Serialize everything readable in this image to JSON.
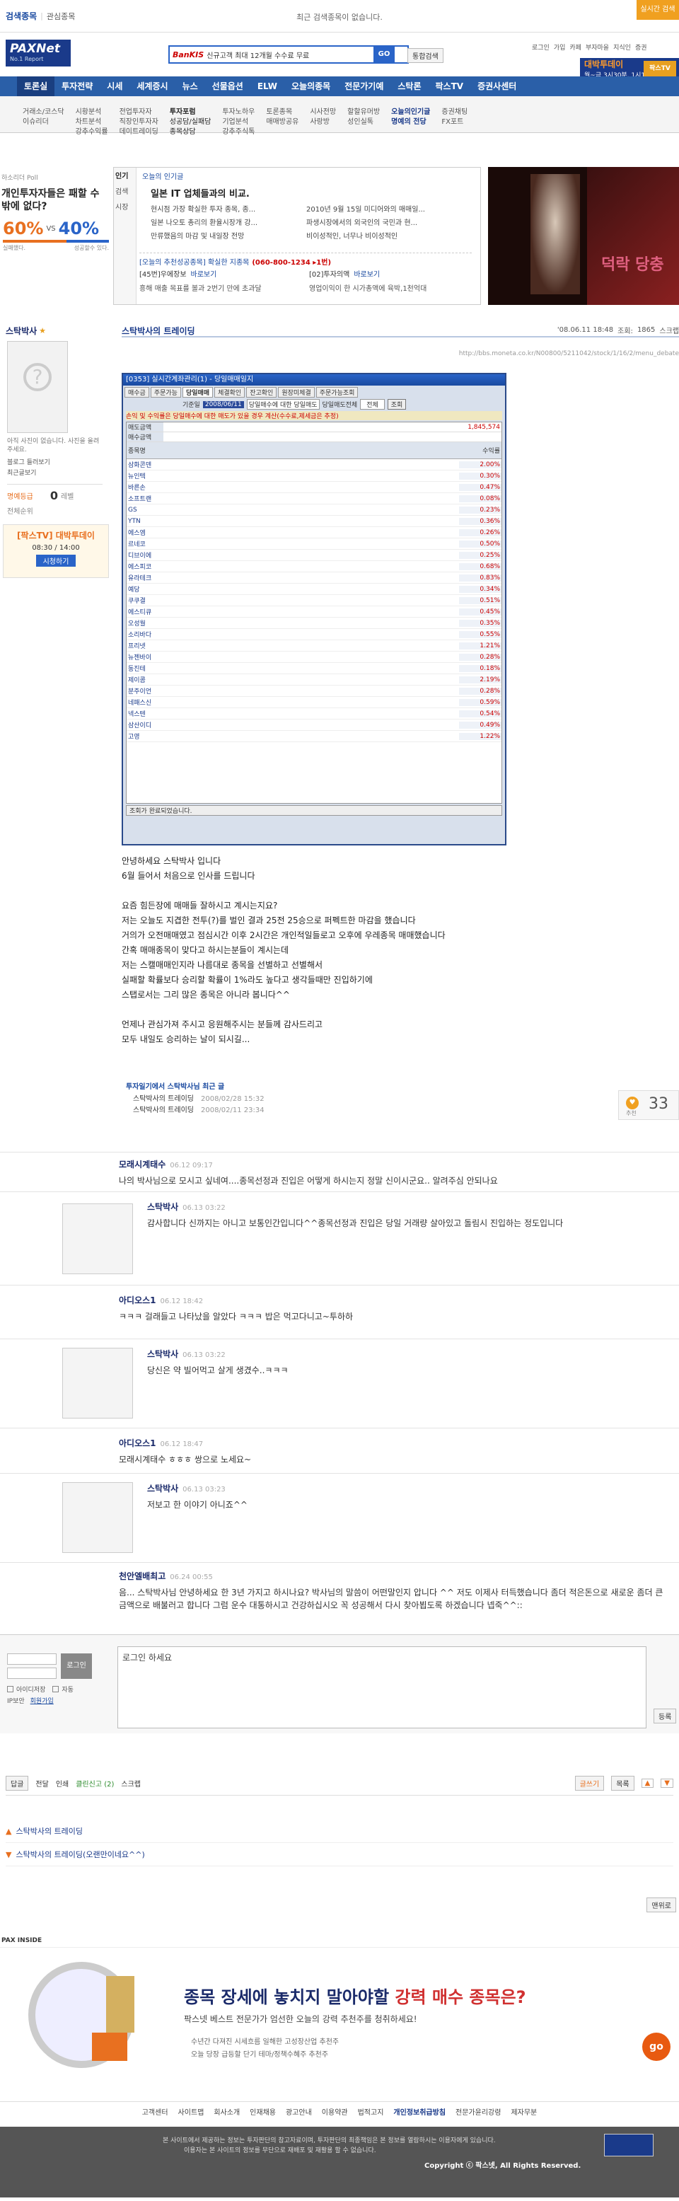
{
  "topbar": {
    "search_label": "검색종목",
    "fav_label": "관심종목",
    "recent": "최근 검색종목이 없습니다.",
    "live_btn": "실시간 검색"
  },
  "header": {
    "logo": "PAXNet",
    "logo_sub": "No.1 Report",
    "banner_brand": "BanKIS",
    "banner_text": "신규고객 최대 12개월 수수료 무료",
    "banner_go": "GO",
    "search_btn": "통합검색",
    "links": [
      "로그인",
      "가입",
      "카페",
      "부자마을",
      "지식인",
      "증권"
    ],
    "promo_title": "대박투데이",
    "promo_sub": "월~금 3시30분, 1시1분",
    "tv": "팍스TV"
  },
  "nav": {
    "items": [
      "토론실",
      "투자전략",
      "시세",
      "세계증시",
      "뉴스",
      "선물옵션",
      "ELW",
      "오늘의종목",
      "전문가기예",
      "스탁론",
      "팍스TV",
      "증권사센터"
    ]
  },
  "subnav": {
    "cols": [
      [
        "거래소/코스닥",
        "이슈리더"
      ],
      [
        "시황분석",
        "차트분석",
        "강추수익률"
      ],
      [
        "전업투자자",
        "직장인투자자",
        "데이트레이딩"
      ],
      [
        "투자포럼",
        "성공담/실패담",
        "종목상담"
      ],
      [
        "투자노하우",
        "기업분석",
        "강추주식톡"
      ],
      [
        "토론종목",
        "매매방공유"
      ],
      [
        "시사전망",
        "사랑방"
      ],
      [
        "할할유머방",
        "성인실톡"
      ],
      [
        "오늘의인기글",
        "명예의 전당"
      ],
      [
        "증권채팅",
        "FX포트"
      ]
    ]
  },
  "poll": {
    "label": "하소리더 Poll",
    "question": "개인투자자들은 패할 수 밖에 없다?",
    "yes": "60%",
    "vs": "VS",
    "no": "40%",
    "yes_label": "실패했다.",
    "no_label": "성공할수 있다."
  },
  "newsbox": {
    "tabs": [
      "인기",
      "검색",
      "시장"
    ],
    "header": "오늘의 인기글",
    "title": "일본 IT 업체들과의 비교.",
    "items": [
      "현시점 가장 확실한 투자 종목, 종...",
      "2010년 9월 15일 미디어와의 매매일...",
      "일본 나오토 총리의 환율시장개 강...",
      "파생시장에서의 외국인의 국민과 현...",
      "만류했음의 마감 및 내일장 전망",
      "비이성적인, 너무나 비이성적인"
    ],
    "hot_title": "[오늘의 추천성공종목] 확실한 지종목",
    "hot_phone": "(060-800-1234 ▸1번)",
    "p1_name": "[45번]우에장보",
    "p1_btn": "바로보기",
    "p2_name": "[02]투자의액",
    "p2_btn": "바로보기",
    "p1_text": "흥해 매출 목표를 볼과 2번기 만에 초과달",
    "p2_text": "영업이익이 한 시가총액에 육박,1천억대"
  },
  "ad1": {
    "text": "덕락 당충"
  },
  "sidebar": {
    "name": "스탁박사",
    "status": "아직 사진이 없습니다. 사진을 올려주세요.",
    "links": [
      "블로그 들러보기",
      "최근글보기"
    ],
    "score_label": "명예등급",
    "score": "0",
    "score_unit": "레벨",
    "rank_label": "전체순위",
    "ad_title": "[팍스TV] 대박투데이",
    "ad_time": "08:30 / 14:00",
    "ad_btn": "시청하기"
  },
  "post": {
    "title": "스탁박사의 트레이딩",
    "date": "'08.06.11 18:48",
    "views_label": "조회:",
    "views": "1865",
    "more": "스크랩",
    "url": "http://bbs.moneta.co.kr/N00800/5211042/stock/1/16/2/menu_debate",
    "win_title": "[0353] 실시간계좌관리(1) - 당일매매일지",
    "win_tabs": [
      "매수금",
      "주문가능",
      "당일매매",
      "체결확인",
      "잔고확인",
      "원장미체결",
      "주문가능조회"
    ],
    "win_label": "기준일",
    "win_date": "2008/06/11",
    "win_opt1": "당일매수에 대한 당일매도",
    "win_opt2": "당일매도전체",
    "win_filter": "전체",
    "win_btn": "조회",
    "win_note": "손익 및 수익률은 당일매수에 대한 매도가 있을 경우 계산(수수료,제세금은 추정)",
    "rows_top": [
      [
        "매도금액",
        "1,845,574"
      ],
      [
        "매수금액",
        ""
      ]
    ],
    "col1": "종목명",
    "col2": "수익률",
    "stocks": [
      [
        "삼화콘덴",
        "2.00%"
      ],
      [
        "뉴인텍",
        "0.30%"
      ],
      [
        "바른손",
        "0.47%"
      ],
      [
        "소프트랜",
        "0.08%"
      ],
      [
        "GS",
        "0.23%"
      ],
      [
        "YTN",
        "0.36%"
      ],
      [
        "에스엠",
        "0.26%"
      ],
      [
        "르네코",
        "0.50%"
      ],
      [
        "디브이에",
        "0.25%"
      ],
      [
        "에스피코",
        "0.68%"
      ],
      [
        "유라테크",
        "0.83%"
      ],
      [
        "예당",
        "0.34%"
      ],
      [
        "쿠쿠결",
        "0.51%"
      ],
      [
        "에스티큐",
        "0.45%"
      ],
      [
        "오성월",
        "0.35%"
      ],
      [
        "소리바다",
        "0.55%"
      ],
      [
        "프리넷",
        "1.21%"
      ],
      [
        "뉴젠바이",
        "0.28%"
      ],
      [
        "동진테",
        "0.18%"
      ],
      [
        "제이콤",
        "2.19%"
      ],
      [
        "분주이언",
        "0.28%"
      ],
      [
        "네패스신",
        "0.59%"
      ],
      [
        "넥스텐",
        "0.54%"
      ],
      [
        "삼산이디",
        "0.49%"
      ],
      [
        "고영",
        "1.22%"
      ]
    ],
    "win_status": "조회가 완료되었습니다.",
    "body": [
      "안녕하세요 스탁박사 입니다",
      "6월 들어서 처음으로 인사를 드립니다",
      "",
      "요즘 힘든장에 매매들 잘하시고 계시는지요?",
      "저는 오늘도 지겹한 전투(?)를 벌인 결과 25전 25승으로 퍼펙트한 마감을 했습니다",
      "거의가 오전매매였고 점심시간 이후 2시간은 개인적일들로고 오후에 우레종목 매매했습니다",
      "간혹 매매종목이 맞다고 하시는분들이 계시는데",
      "저는 스캘매매인지라 나름대로 종목을 선별하고 선별해서",
      "실패할 확률보다 승리할 확률이 1%라도 높다고 생각들때만 진입하기에",
      "스탭로서는 그리 많은 종목은 아니라 봅니다^^",
      "",
      "언제나 관심가져 주시고 응원해주시는 분들께 감사드리고",
      "모두 내일도 승리하는 날이 되시길..."
    ],
    "recent_title": "투자일기에서 스탁박사님 최근 글",
    "recent": [
      [
        "스탁박사의 트레이딩",
        "2008/02/28 15:32"
      ],
      [
        "스탁박사의 트레이딩",
        "2008/02/11 23:34"
      ]
    ],
    "recommend": "33",
    "rec_label": "추천"
  },
  "comments": [
    {
      "name": "모래시계태수",
      "date": "06.12 09:17",
      "text": "나의 박사님으로 모시고 싶네여....종목선정과 진입은 어떻게 하시는지 정말 신이시군요.. 알려주심 안되나요"
    },
    {
      "name": "스탁박사",
      "date": "06.13 03:22",
      "text": "감사합니다 신까지는 아니고 보통인간입니다^^종목선정과 진입은 당일 거래량 살아있고 돌림시 진입하는 정도입니다"
    },
    {
      "name": "아디오스1",
      "date": "06.12 18:42",
      "text": "ㅋㅋㅋ 걸래들고 나타났을 알았다 ㅋㅋㅋ 밥은 먹고다니고~투하하"
    },
    {
      "name": "스탁박사",
      "date": "06.13 03:22",
      "text": "당신은 약 빌어먹고 살게 생겼수..ㅋㅋㅋ"
    },
    {
      "name": "아디오스1",
      "date": "06.12 18:47",
      "text": "모래시계태수 ㅎㅎㅎ 쌍으로 노세요~"
    },
    {
      "name": "스탁박사",
      "date": "06.13 03:23",
      "text": "저보고 한 이야기 아니죠^^"
    },
    {
      "name": "천안엘배최고",
      "date": "06.24 00:55",
      "text": "음... 스탁박사님 안녕하세요 한 3년 가지고 하시나요? 박사님의 말씀이 어떤말인지 압니다 ^^ 저도 이제사 터득했습니다 좀더 적은돈으로 새로운 좀더 큰금액으로 배불러고 합니다 그럼 운수 대통하시고 건강하십시오 꼭 성공해서 다시 찾아뵙도록 하겠습니다 넵죽^^::"
    }
  ],
  "comment_form": {
    "login_btn": "로그인",
    "placeholder": "로그인 하세요",
    "auto": "자동",
    "reg": "회원가입",
    "submit": "등록",
    "id_label": "아이디저장",
    "ip": "IP보안"
  },
  "actions": {
    "left": [
      "답글",
      "전달",
      "인쇄",
      "클린신고 (2)",
      "스크랩"
    ],
    "right": [
      "글쓰기",
      "목록"
    ]
  },
  "related": [
    "스탁박사의 트레이딩",
    "스탁박사의 트레이딩(오랜만이네요^^)"
  ],
  "top_link": "맨위로",
  "inside_label": "PAX INSIDE",
  "ad2": {
    "headline1": "종목 장세에 놓치지 말아야할",
    "headline2": "강력 매수 종목은?",
    "sub": "팍스넷 베스트 전문가가 엄선한 오늘의 강력 추천주를 청취하세요!",
    "b1": "수년간 다져진 시세흐름 일해한 고성장산업 추천주",
    "b2": "오늘 당장 급등할 단기 테마/정책수혜주 추천주",
    "go": "go"
  },
  "footer": {
    "links": [
      "고객센터",
      "사이트맵",
      "회사소개",
      "인재채용",
      "광고안내",
      "이용약관",
      "법적고지",
      "개인정보취급방침",
      "전문가윤리강령",
      "제자무분"
    ],
    "notice1": "본 사이트에서 제공하는 정보는 투자판단의 참고자료이며, 투자판단의 최종책임은 본 정보를 열람하시는 이용자에게 있습니다.",
    "notice2": "이용자는 본 사이트의 정보를 무단으로 재배포 및 재활용 할 수 없습니다.",
    "copy": "Copyright ⓒ 팍스넷, All Rights Reserved."
  }
}
